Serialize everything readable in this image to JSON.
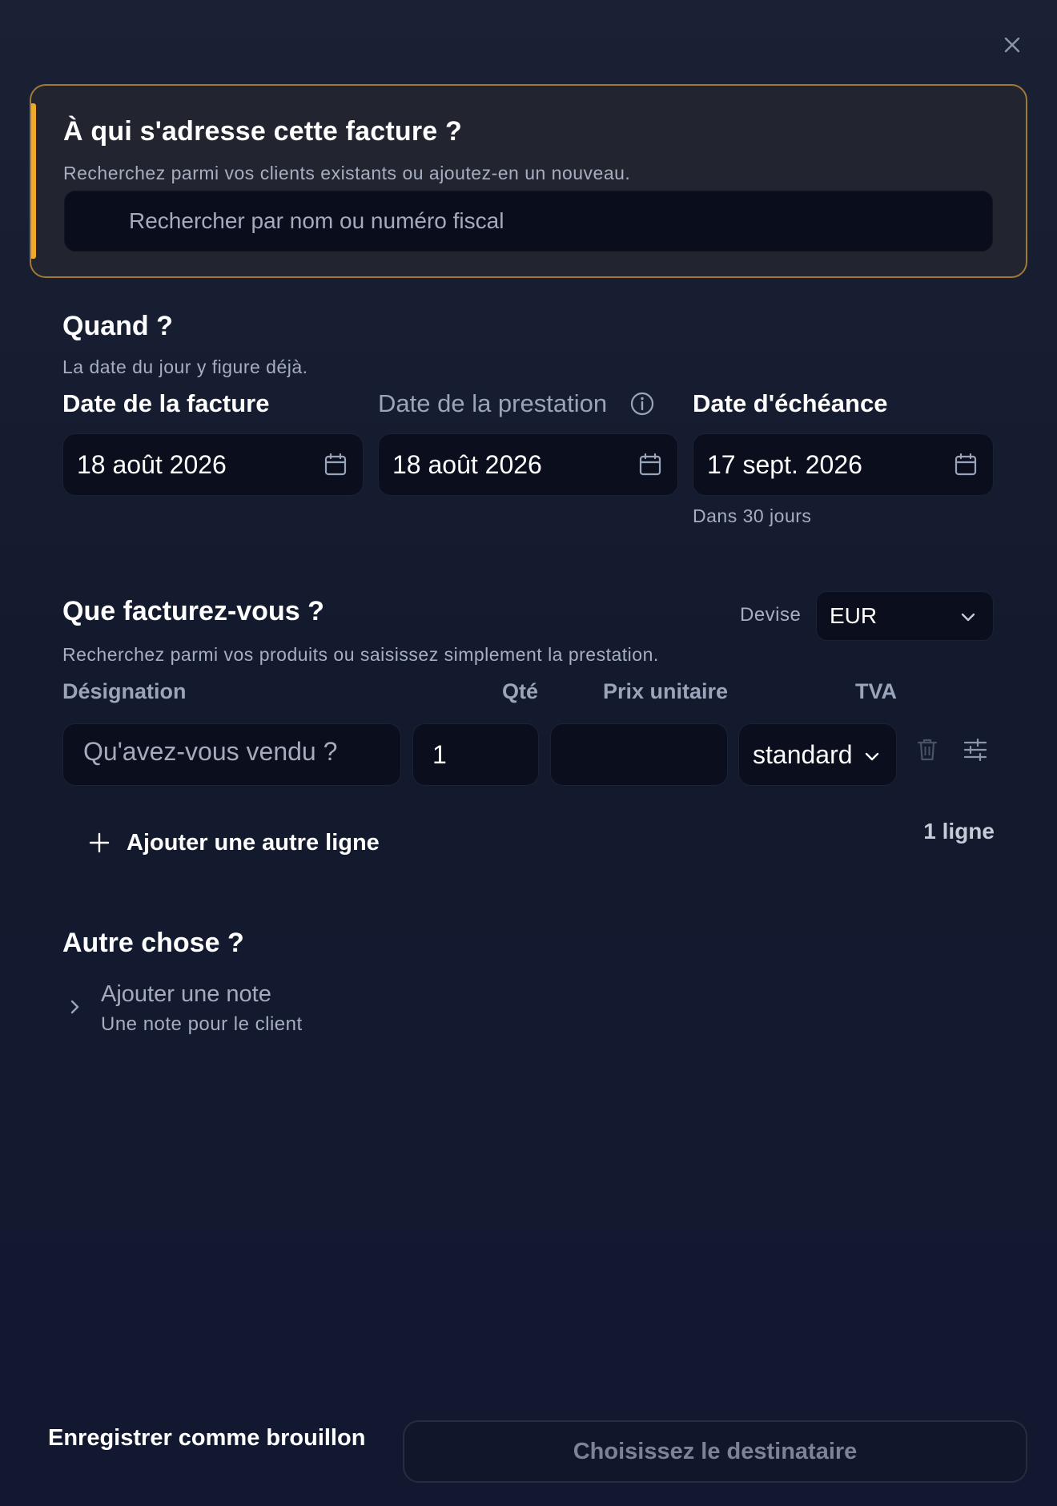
{
  "recipient": {
    "title": "À qui s'adresse cette facture ?",
    "subtitle": "Recherchez parmi vos clients existants ou ajoutez-en un nouveau.",
    "search_placeholder": "Rechercher par nom ou numéro fiscal",
    "accent_color": "#f0a92b"
  },
  "when": {
    "title": "Quand ?",
    "subtitle": "La date du jour y figure déjà.",
    "invoice_date": {
      "label": "Date de la facture",
      "value": "18 août 2026"
    },
    "service_date": {
      "label": "Date de la prestation",
      "value": "18 août 2026"
    },
    "due_date": {
      "label": "Date d'échéance",
      "value": "17 sept. 2026",
      "hint": "Dans 30 jours"
    }
  },
  "items": {
    "title": "Que facturez-vous ?",
    "subtitle": "Recherchez parmi vos produits ou saisissez simplement la prestation.",
    "currency_label": "Devise",
    "currency_value": "EUR",
    "columns": {
      "designation": "Désignation",
      "qty": "Qté",
      "unit_price": "Prix unitaire",
      "vat": "TVA"
    },
    "row": {
      "designation_placeholder": "Qu'avez-vous vendu ?",
      "qty": "1",
      "unit_price": "",
      "vat": "standard"
    },
    "add_line_label": "Ajouter une autre ligne",
    "line_count": "1 ligne"
  },
  "other": {
    "title": "Autre chose ?",
    "note_title": "Ajouter une note",
    "note_desc": "Une note pour le client"
  },
  "footer": {
    "draft_label": "Enregistrer comme brouillon",
    "primary_label": "Choisissez le destinataire"
  }
}
